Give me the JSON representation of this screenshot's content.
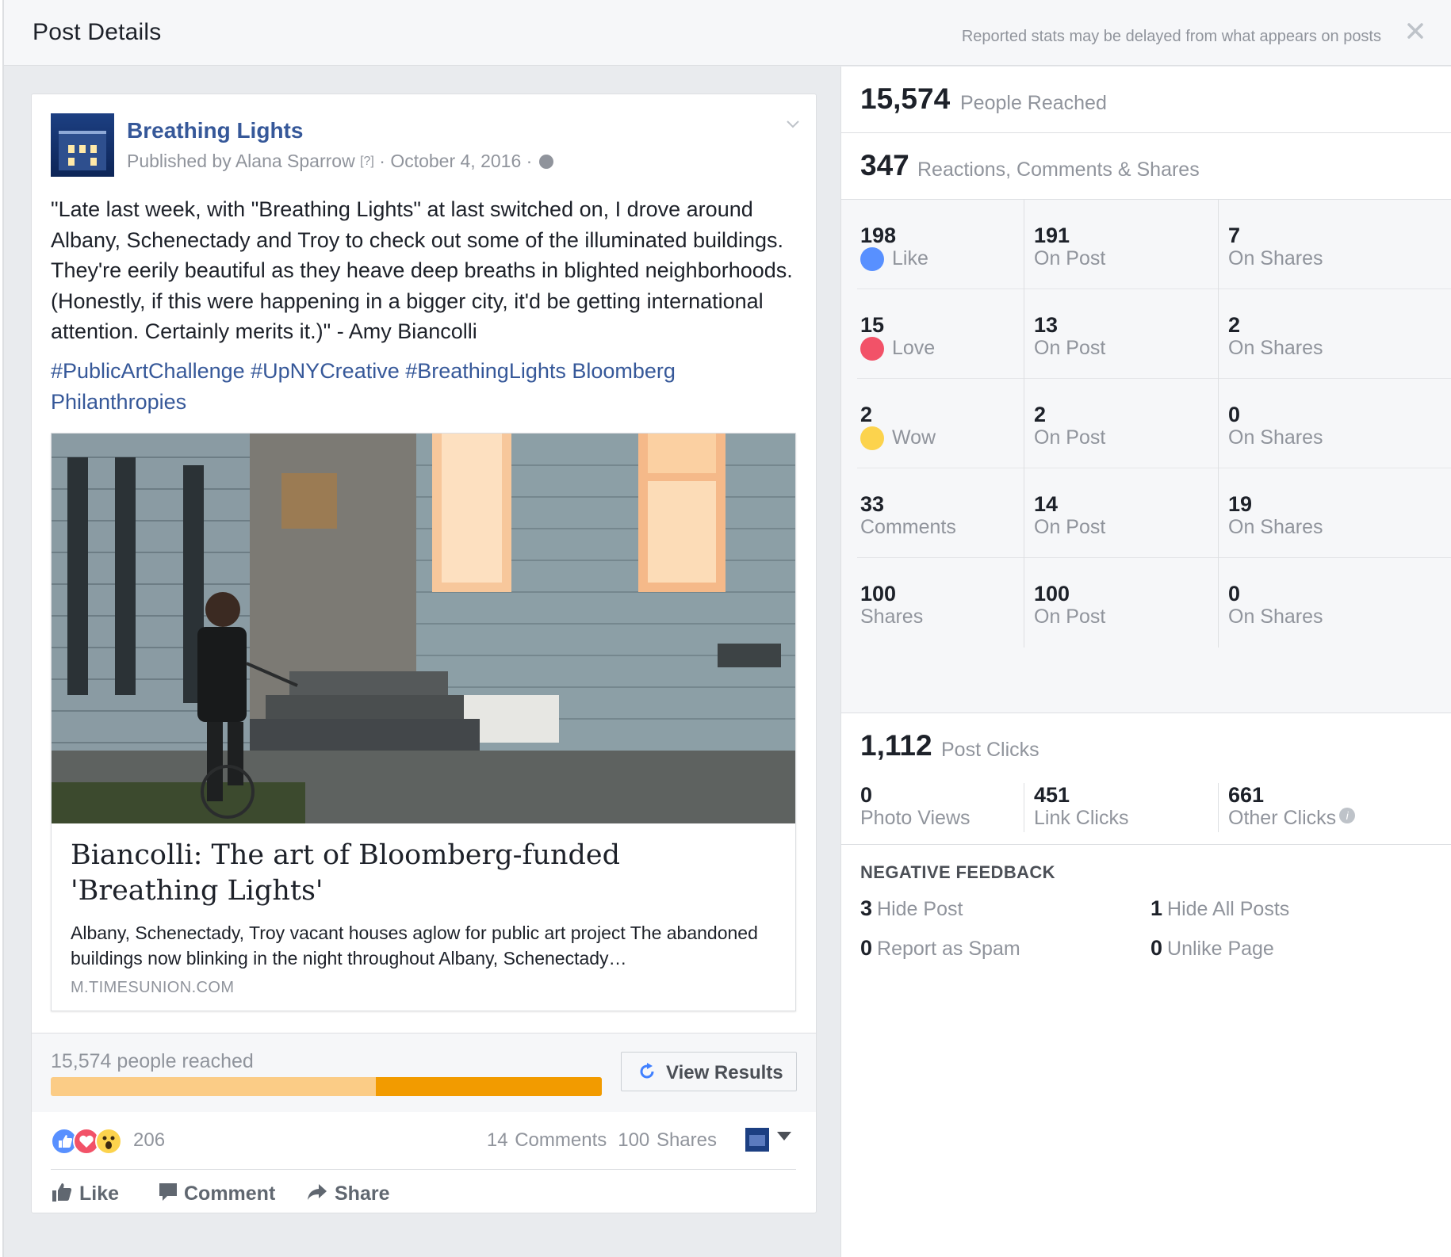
{
  "header": {
    "title": "Post Details",
    "notice": "Reported stats may be delayed from what appears on posts",
    "close_icon": "close-icon"
  },
  "post": {
    "page_name": "Breathing Lights",
    "published_by": "Published by Alana Sparrow",
    "help_marker": "[?]",
    "date": "· October 4, 2016 ·",
    "audience_icon": "globe-icon",
    "text": "\"Late last week, with \"Breathing Lights\" at last switched on, I drove around Albany, Schenectady and Troy to check out some of the illuminated buildings. They're eerily beautiful as they heave deep breaths in blighted neighborhoods. (Honestly, if this were happening in a bigger city, it'd be getting international attention. Certainly merits it.)\" - Amy Biancolli",
    "tags": "#PublicArtChallenge #UpNYCreative #BreathingLights Bloomberg Philanthropies",
    "link": {
      "title": "Biancolli: The art of Bloomberg-funded 'Breathing Lights'",
      "description": "Albany, Schenectady, Troy vacant houses aglow for public art project The abandoned buildings now blinking in the night throughout Albany, Schenectady…",
      "source": "M.TIMESUNION.COM"
    },
    "reach": {
      "text": "15,574 people reached",
      "paid_fraction": 0.41,
      "button_label": "View Results"
    },
    "reactions": {
      "count": "206",
      "comments": "14 Comments",
      "shares": "100 Shares"
    },
    "actions": [
      "Like",
      "Comment",
      "Share"
    ]
  },
  "stats": {
    "reached": {
      "value": "15,574",
      "label": "People Reached"
    },
    "engagement": {
      "value": "347",
      "label": "Reactions, Comments & Shares"
    },
    "rows": [
      {
        "total": "198",
        "label": "Like",
        "icon": "like-icon",
        "on_post": "191",
        "on_shares": "7"
      },
      {
        "total": "15",
        "label": "Love",
        "icon": "love-icon",
        "on_post": "13",
        "on_shares": "2"
      },
      {
        "total": "2",
        "label": "Wow",
        "icon": "wow-icon",
        "on_post": "2",
        "on_shares": "0"
      },
      {
        "total": "33",
        "label": "Comments",
        "on_post": "14",
        "on_shares": "19"
      },
      {
        "total": "100",
        "label": "Shares",
        "on_post": "100",
        "on_shares": "0"
      }
    ],
    "on_post_label": "On Post",
    "on_shares_label": "On Shares",
    "clicks": {
      "value": "1,112",
      "label": "Post Clicks",
      "photo_views": {
        "value": "0",
        "label": "Photo Views"
      },
      "link_clicks": {
        "value": "451",
        "label": "Link Clicks"
      },
      "other_clicks": {
        "value": "661",
        "label": "Other Clicks"
      }
    },
    "negative": {
      "title": "NEGATIVE FEEDBACK",
      "hide_post": {
        "value": "3",
        "label": "Hide Post"
      },
      "hide_all": {
        "value": "1",
        "label": "Hide All Posts"
      },
      "spam": {
        "value": "0",
        "label": "Report as Spam"
      },
      "unlike": {
        "value": "0",
        "label": "Unlike Page"
      }
    }
  },
  "colors": {
    "link_blue": "#365899",
    "paid_orange": "#f29b00",
    "organic_orange": "#fbcc86",
    "like_blue": "#5890ff",
    "love_red": "#f25268",
    "wow_yellow": "#fcd34d"
  }
}
